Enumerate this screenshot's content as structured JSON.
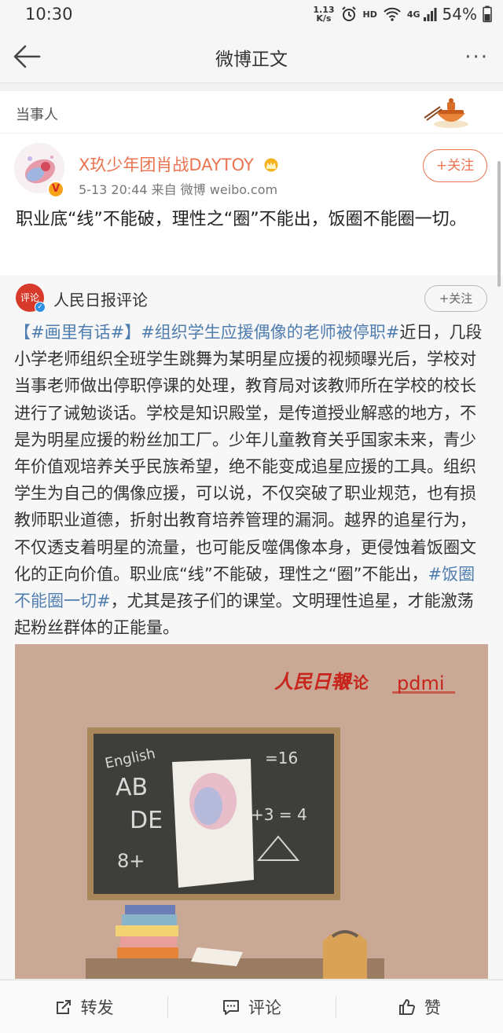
{
  "status_bar": {
    "time": "10:30",
    "net_speed_value": "1.13",
    "net_speed_unit": "K/s",
    "hd": "HD",
    "network": "4G",
    "battery": "54%"
  },
  "nav": {
    "title": "微博正文",
    "more": "···"
  },
  "post": {
    "label": "当事人",
    "author_name": "X玖少年团肖战DAYTOY",
    "meta": "5-13 20:44  来自 微博 weibo.com",
    "follow_label": "+关注",
    "verified_badge": "V",
    "text": "职业底“线”不能破，理性之“圈”不能出，饭圈不能圈一切。"
  },
  "repost": {
    "author_name": "人民日报评论",
    "avatar_text": "评论",
    "follow_label": "+关注",
    "segments": {
      "tag1": "【#画里有话#】",
      "tag2": "#组织学生应援偶像的老师被停职#",
      "body1": "近日，几段小学老师组织全班学生跳舞为某明星应援的视频曝光后，学校对当事老师做出停职停课的处理，教育局对该教师所在学校的校长进行了诫勉谈话。学校是知识殿堂，是传道授业解惑的地方，不是为明星应援的粉丝加工厂。少年儿童教育关乎国家未来，青少年价值观培养关乎民族希望，绝不能变成追星应援的工具。组织学生为自己的偶像应援，可以说，不仅突破了职业规范，也有损教师职业道德，折射出教育培养管理的漏洞。越界的追星行为，不仅透支着明星的流量，也可能反噬偶像本身，更侵蚀着饭圈文化的正向价值。职业底“线”不能破，理性之“圈”不能出，",
      "tag3": "#饭圈不能圈一切#",
      "body2": "，尤其是孩子们的课堂。文明理性追星，才能激荡起粉丝群体的正能量。"
    },
    "image": {
      "brand_text": "人民日報",
      "brand_sub": "评论",
      "logo_text": "pdmi",
      "chalk_english": "English",
      "chalk_letters1": "AB",
      "chalk_letters2": "DE",
      "chalk_eq1": "=16",
      "chalk_eq2": "+3 = 4",
      "chalk_eq3": "8+"
    }
  },
  "actions": {
    "repost": "转发",
    "comment": "评论",
    "like": "赞"
  },
  "colors": {
    "accent": "#eb7350",
    "link": "#507daf"
  }
}
